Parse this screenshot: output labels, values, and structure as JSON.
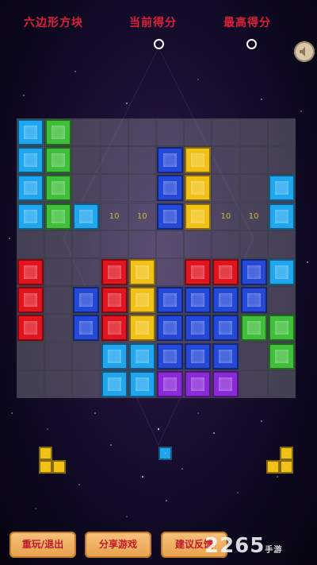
{
  "header": {
    "game_title": "六边形方块",
    "current_score_label": "当前得分",
    "best_score_label": "最高得分"
  },
  "board": {
    "cols": 10,
    "rows": 10,
    "tiles": [
      {
        "r": 0,
        "c": 0,
        "color": "cyan"
      },
      {
        "r": 0,
        "c": 1,
        "color": "green"
      },
      {
        "r": 1,
        "c": 0,
        "color": "cyan"
      },
      {
        "r": 1,
        "c": 1,
        "color": "green"
      },
      {
        "r": 1,
        "c": 5,
        "color": "blue"
      },
      {
        "r": 1,
        "c": 6,
        "color": "yellow"
      },
      {
        "r": 2,
        "c": 0,
        "color": "cyan"
      },
      {
        "r": 2,
        "c": 1,
        "color": "green"
      },
      {
        "r": 2,
        "c": 5,
        "color": "blue"
      },
      {
        "r": 2,
        "c": 6,
        "color": "yellow"
      },
      {
        "r": 2,
        "c": 9,
        "color": "cyan"
      },
      {
        "r": 3,
        "c": 0,
        "color": "cyan"
      },
      {
        "r": 3,
        "c": 1,
        "color": "green"
      },
      {
        "r": 3,
        "c": 2,
        "color": "cyan"
      },
      {
        "r": 3,
        "c": 5,
        "color": "blue"
      },
      {
        "r": 3,
        "c": 6,
        "color": "yellow"
      },
      {
        "r": 3,
        "c": 9,
        "color": "cyan"
      },
      {
        "r": 5,
        "c": 0,
        "color": "red"
      },
      {
        "r": 5,
        "c": 3,
        "color": "red"
      },
      {
        "r": 5,
        "c": 4,
        "color": "yellow"
      },
      {
        "r": 5,
        "c": 6,
        "color": "red"
      },
      {
        "r": 5,
        "c": 7,
        "color": "red"
      },
      {
        "r": 5,
        "c": 8,
        "color": "blue"
      },
      {
        "r": 5,
        "c": 9,
        "color": "cyan"
      },
      {
        "r": 6,
        "c": 0,
        "color": "red"
      },
      {
        "r": 6,
        "c": 2,
        "color": "blue"
      },
      {
        "r": 6,
        "c": 3,
        "color": "red"
      },
      {
        "r": 6,
        "c": 4,
        "color": "yellow"
      },
      {
        "r": 6,
        "c": 5,
        "color": "blue"
      },
      {
        "r": 6,
        "c": 6,
        "color": "blue"
      },
      {
        "r": 6,
        "c": 7,
        "color": "blue"
      },
      {
        "r": 6,
        "c": 8,
        "color": "blue"
      },
      {
        "r": 7,
        "c": 0,
        "color": "red"
      },
      {
        "r": 7,
        "c": 2,
        "color": "blue"
      },
      {
        "r": 7,
        "c": 3,
        "color": "red"
      },
      {
        "r": 7,
        "c": 4,
        "color": "yellow"
      },
      {
        "r": 7,
        "c": 5,
        "color": "blue"
      },
      {
        "r": 7,
        "c": 6,
        "color": "blue"
      },
      {
        "r": 7,
        "c": 7,
        "color": "blue"
      },
      {
        "r": 7,
        "c": 8,
        "color": "green"
      },
      {
        "r": 7,
        "c": 9,
        "color": "green"
      },
      {
        "r": 8,
        "c": 3,
        "color": "cyan"
      },
      {
        "r": 8,
        "c": 4,
        "color": "cyan"
      },
      {
        "r": 8,
        "c": 5,
        "color": "blue"
      },
      {
        "r": 8,
        "c": 6,
        "color": "blue"
      },
      {
        "r": 8,
        "c": 7,
        "color": "blue"
      },
      {
        "r": 8,
        "c": 9,
        "color": "green"
      },
      {
        "r": 9,
        "c": 3,
        "color": "cyan"
      },
      {
        "r": 9,
        "c": 4,
        "color": "cyan"
      },
      {
        "r": 9,
        "c": 5,
        "color": "purple"
      },
      {
        "r": 9,
        "c": 6,
        "color": "purple"
      },
      {
        "r": 9,
        "c": 7,
        "color": "purple"
      }
    ],
    "row_hint": {
      "row": 3,
      "value": "10"
    }
  },
  "colors": {
    "cyan": "#1fa6ef",
    "green": "#3fbf3a",
    "blue": "#2448d8",
    "yellow": "#f1c215",
    "red": "#e0151f",
    "purple": "#8a2ad8"
  },
  "pieces": [
    {
      "name": "piece-left",
      "color": "yellow",
      "cells": [
        [
          0,
          0
        ],
        [
          1,
          0
        ],
        [
          1,
          1
        ]
      ]
    },
    {
      "name": "piece-center",
      "color": "cyan",
      "cells": [
        [
          0,
          0
        ]
      ]
    },
    {
      "name": "piece-right",
      "color": "yellow",
      "cells": [
        [
          0,
          1
        ],
        [
          1,
          0
        ],
        [
          1,
          1
        ]
      ]
    }
  ],
  "buttons": {
    "replay_exit": "重玩/退出",
    "share_game": "分享游戏",
    "suggest": "建议反馈"
  },
  "watermark": {
    "brand": "2265",
    "suffix": "手游"
  }
}
